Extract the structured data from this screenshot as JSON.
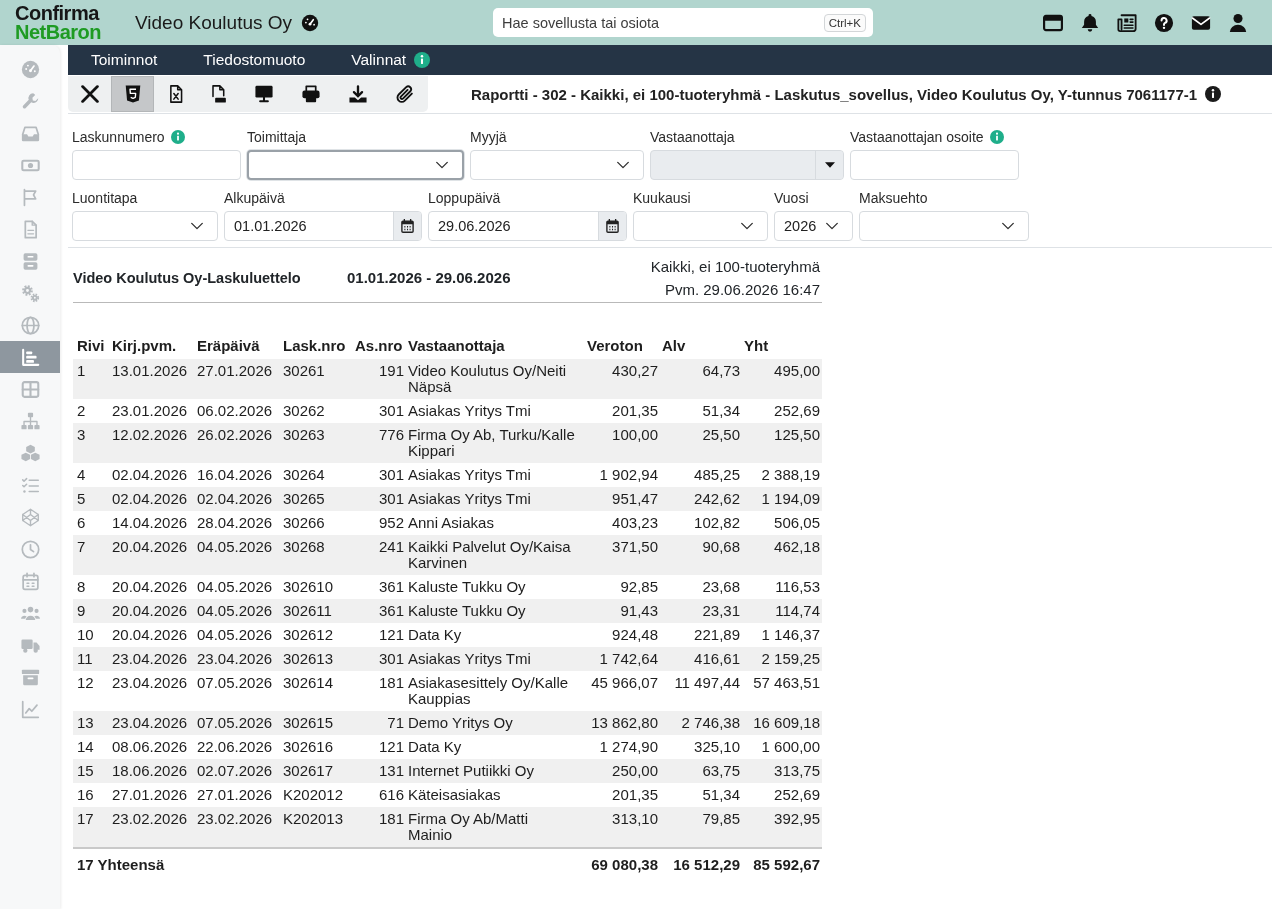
{
  "header": {
    "logo": {
      "line_1": "Confirma",
      "line_2": "NetBaron"
    },
    "company": "Video Koulutus Oy",
    "search": {
      "placeholder": "Hae sovellusta tai osiota",
      "shortcut": "Ctrl+K"
    }
  },
  "sidebar": {
    "items": [
      {
        "selected": false
      },
      {
        "selected": false
      },
      {
        "selected": false
      },
      {
        "selected": false
      },
      {
        "selected": false
      },
      {
        "selected": false
      },
      {
        "selected": false
      },
      {
        "selected": false
      },
      {
        "selected": false
      },
      {
        "selected": true
      },
      {
        "selected": false
      },
      {
        "selected": false
      },
      {
        "selected": false
      },
      {
        "selected": false
      },
      {
        "selected": false
      },
      {
        "selected": false
      },
      {
        "selected": false
      },
      {
        "selected": false
      },
      {
        "selected": false
      },
      {
        "selected": false
      },
      {
        "selected": false
      }
    ]
  },
  "menu": [
    {
      "label": "Toiminnot",
      "info": false
    },
    {
      "label": "Tiedostomuoto",
      "info": false
    },
    {
      "label": "Valinnat",
      "info": true
    }
  ],
  "toolbar": {
    "buttons": [
      {
        "selected": false
      },
      {
        "selected": true
      },
      {
        "selected": false
      },
      {
        "selected": false
      },
      {
        "selected": false
      },
      {
        "selected": false
      },
      {
        "selected": false
      },
      {
        "selected": false
      }
    ],
    "report_title": "Raportti - 302 - Kaikki, ei 100-tuoteryhmä - Laskutus_sovellus, Video Koulutus Oy, Y-tunnus 7061177-1"
  },
  "filter_rows": [
    {
      "fields": [
        {
          "label": "Laskunnumero",
          "kind": "text",
          "info": true,
          "focused": false,
          "disabled": false
        },
        {
          "label": "Toimittaja",
          "kind": "select",
          "info": false,
          "focused": true,
          "disabled": false
        },
        {
          "label": "Myyjä",
          "kind": "select",
          "info": false,
          "focused": false,
          "disabled": false
        },
        {
          "label": "Vastaanottaja",
          "kind": "combo",
          "info": false,
          "focused": false,
          "disabled": true
        },
        {
          "label": "Vastaanottajan osoite",
          "kind": "text",
          "info": true,
          "focused": false,
          "disabled": false
        }
      ]
    },
    {
      "fields": [
        {
          "label": "Luontitapa",
          "kind": "select",
          "info": false,
          "focused": false,
          "disabled": false
        },
        {
          "label": "Alkupäivä",
          "kind": "date",
          "value": "01.01.2026",
          "info": false,
          "focused": false,
          "disabled": false
        },
        {
          "label": "Loppupäivä",
          "kind": "date",
          "value": "29.06.2026",
          "info": false,
          "focused": false,
          "disabled": false
        },
        {
          "label": "Kuukausi",
          "kind": "select",
          "info": false,
          "focused": false,
          "disabled": false
        },
        {
          "label": "Vuosi",
          "kind": "select",
          "value": "2026",
          "info": false,
          "focused": false,
          "disabled": false
        },
        {
          "label": "Maksuehto",
          "kind": "select",
          "info": false,
          "focused": false,
          "disabled": false
        }
      ]
    }
  ],
  "report": {
    "title": "Video Koulutus Oy-Laskuluettelo",
    "period": "01.01.2026 - 29.06.2026",
    "group": "Kaikki, ei 100-tuoteryhmä",
    "printed": "Pvm. 29.06.2026 16:47",
    "table": {
      "columns": [
        "Rivi",
        "Kirj.pvm.",
        "Eräpäivä",
        "Lask.nro",
        "As.nro",
        "Vastaanottaja",
        "Veroton",
        "Alv",
        "Yht"
      ],
      "rows": [
        [
          "1",
          "13.01.2026",
          "27.01.2026",
          "30261",
          "191",
          "Video Koulutus Oy/Neiti Näpsä",
          "430,27",
          "64,73",
          "495,00"
        ],
        [
          "2",
          "23.01.2026",
          "06.02.2026",
          "30262",
          "301",
          "Asiakas Yritys Tmi",
          "201,35",
          "51,34",
          "252,69"
        ],
        [
          "3",
          "12.02.2026",
          "26.02.2026",
          "30263",
          "776",
          "Firma Oy Ab, Turku/Kalle Kippari",
          "100,00",
          "25,50",
          "125,50"
        ],
        [
          "4",
          "02.04.2026",
          "16.04.2026",
          "30264",
          "301",
          "Asiakas Yritys Tmi",
          "1 902,94",
          "485,25",
          "2 388,19"
        ],
        [
          "5",
          "02.04.2026",
          "02.04.2026",
          "30265",
          "301",
          "Asiakas Yritys Tmi",
          "951,47",
          "242,62",
          "1 194,09"
        ],
        [
          "6",
          "14.04.2026",
          "28.04.2026",
          "30266",
          "952",
          "Anni Asiakas",
          "403,23",
          "102,82",
          "506,05"
        ],
        [
          "7",
          "20.04.2026",
          "04.05.2026",
          "30268",
          "241",
          "Kaikki Palvelut Oy/Kaisa Karvinen",
          "371,50",
          "90,68",
          "462,18"
        ],
        [
          "8",
          "20.04.2026",
          "04.05.2026",
          "302610",
          "361",
          "Kaluste Tukku Oy",
          "92,85",
          "23,68",
          "116,53"
        ],
        [
          "9",
          "20.04.2026",
          "04.05.2026",
          "302611",
          "361",
          "Kaluste Tukku Oy",
          "91,43",
          "23,31",
          "114,74"
        ],
        [
          "10",
          "20.04.2026",
          "04.05.2026",
          "302612",
          "121",
          "Data Ky",
          "924,48",
          "221,89",
          "1 146,37"
        ],
        [
          "11",
          "23.04.2026",
          "23.04.2026",
          "302613",
          "301",
          "Asiakas Yritys Tmi",
          "1 742,64",
          "416,61",
          "2 159,25"
        ],
        [
          "12",
          "23.04.2026",
          "07.05.2026",
          "302614",
          "181",
          "Asiakasesittely Oy/Kalle Kauppias",
          "45 966,07",
          "11 497,44",
          "57 463,51"
        ],
        [
          "13",
          "23.04.2026",
          "07.05.2026",
          "302615",
          "71",
          "Demo Yritys Oy",
          "13 862,80",
          "2 746,38",
          "16 609,18"
        ],
        [
          "14",
          "08.06.2026",
          "22.06.2026",
          "302616",
          "121",
          "Data Ky",
          "1 274,90",
          "325,10",
          "1 600,00"
        ],
        [
          "15",
          "18.06.2026",
          "02.07.2026",
          "302617",
          "131",
          "Internet Putiikki Oy",
          "250,00",
          "63,75",
          "313,75"
        ],
        [
          "16",
          "27.01.2026",
          "27.01.2026",
          "K202012",
          "616",
          "Käteisasiakas",
          "201,35",
          "51,34",
          "252,69"
        ],
        [
          "17",
          "23.02.2026",
          "23.02.2026",
          "K202013",
          "181",
          "Firma Oy Ab/Matti Mainio",
          "313,10",
          "79,85",
          "392,95"
        ]
      ],
      "totals": {
        "label": "17 Yhteensä",
        "values": [
          "69 080,38",
          "16 512,29",
          "85 592,67"
        ]
      }
    }
  }
}
